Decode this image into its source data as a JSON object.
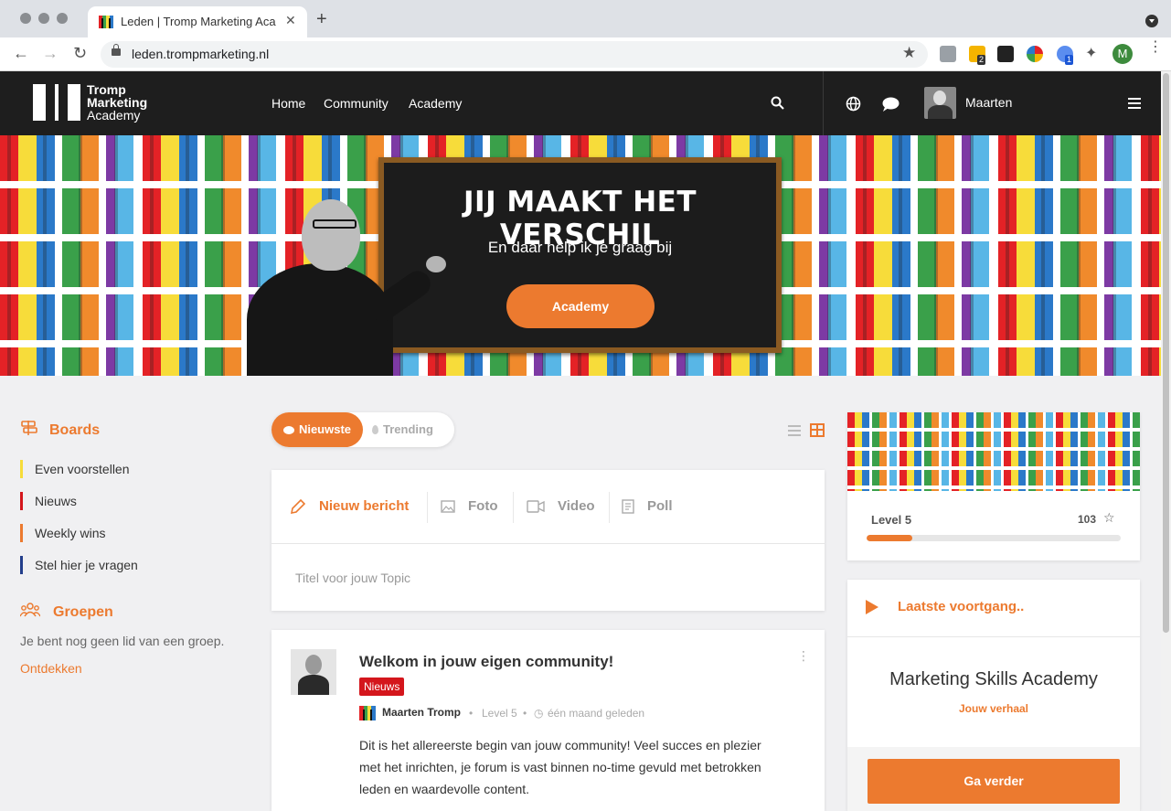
{
  "browser": {
    "tab_title": "Leden | Tromp Marketing Academy",
    "tab_close": "✕",
    "new_tab": "+",
    "url": "leden.trompmarketing.nl",
    "back": "←",
    "forward": "→",
    "reload": "↻",
    "bookmark": "★",
    "ext_badge_1": "2",
    "ext_badge_2": "1",
    "profile_initial": "M",
    "menu": "⋮"
  },
  "header": {
    "logo_line1": "Tromp",
    "logo_line2": "Marketing",
    "logo_line3": "Academy",
    "nav": [
      "Home",
      "Community",
      "Academy"
    ],
    "user_name": "Maarten"
  },
  "hero": {
    "title": "JIJ MAAKT HET VERSCHIL",
    "subtitle": "En daar help ik je graag bij",
    "button": "Academy"
  },
  "sidebar": {
    "boards_title": "Boards",
    "boards": [
      {
        "label": "Even voorstellen",
        "color": "#f7dc3a"
      },
      {
        "label": "Nieuws",
        "color": "#d4161c"
      },
      {
        "label": "Weekly wins",
        "color": "#ec7a2f"
      },
      {
        "label": "Stel hier je vragen",
        "color": "#233e8b"
      }
    ],
    "groups_title": "Groepen",
    "groups_empty": "Je bent nog geen lid van een groep.",
    "groups_link": "Ontdekken"
  },
  "sort": {
    "newest": "Nieuwste",
    "trending": "Trending"
  },
  "composer": {
    "tabs": [
      "Nieuw bericht",
      "Foto",
      "Video",
      "Poll"
    ],
    "placeholder": "Titel voor jouw Topic"
  },
  "post": {
    "title": "Welkom in jouw eigen community!",
    "category": "Nieuws",
    "author": "Maarten Tromp",
    "level": "Level 5",
    "time": "één maand geleden",
    "body": "Dit is het allereerste begin van jouw community! Veel succes en plezier met het inrichten, je forum is vast binnen no-time gevuld met betrokken leden en waardevolle content."
  },
  "level_card": {
    "level": "Level 5",
    "points": "103",
    "progress_pct": 18
  },
  "course_card": {
    "heading": "Laatste voortgang..",
    "course": "Marketing Skills Academy",
    "subtitle": "Jouw verhaal",
    "button": "Ga verder"
  },
  "colors": {
    "accent": "#ec7a2f",
    "header_bg": "#1e1e1e",
    "badge_red": "#d4161c"
  }
}
